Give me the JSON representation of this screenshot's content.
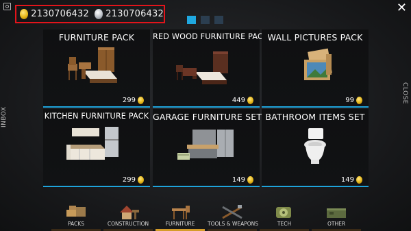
{
  "header": {
    "gold_amount": "2130706432",
    "silver_amount": "2130706432",
    "pages": [
      {
        "active": true
      },
      {
        "active": false
      },
      {
        "active": false
      }
    ]
  },
  "side": {
    "left_label": "INBOX",
    "right_label": "CLOSE",
    "close_glyph": "✕"
  },
  "packs": [
    {
      "title": "FURNITURE PACK",
      "price": "299",
      "icon": "furniture-set-icon"
    },
    {
      "title": "RED WOOD FURNITURE PACK",
      "price": "449",
      "icon": "red-wood-furniture-icon"
    },
    {
      "title": "WALL PICTURES PACK",
      "price": "99",
      "icon": "wall-pictures-icon"
    },
    {
      "title": "KITCHEN FURNITURE PACK",
      "price": "299",
      "icon": "kitchen-furniture-icon"
    },
    {
      "title": "GARAGE FURNITURE SET",
      "price": "149",
      "icon": "garage-furniture-icon"
    },
    {
      "title": "BATHROOM ITEMS SET",
      "price": "149",
      "icon": "toilet-icon"
    }
  ],
  "tabs": [
    {
      "label": "PACKS",
      "icon": "packs-icon",
      "active": false
    },
    {
      "label": "CONSTRUCTION",
      "icon": "construction-icon",
      "active": false
    },
    {
      "label": "FURNITURE",
      "icon": "furniture-icon",
      "active": true
    },
    {
      "label": "TOOLS & WEAPONS",
      "icon": "tools-weapons-icon",
      "active": false
    },
    {
      "label": "TECH",
      "icon": "tech-icon",
      "active": false
    },
    {
      "label": "OTHER",
      "icon": "other-icon",
      "active": false
    }
  ],
  "colors": {
    "accent": "#1ea3db",
    "highlight_border": "#e3141b",
    "active_tab": "#d59c2a"
  }
}
